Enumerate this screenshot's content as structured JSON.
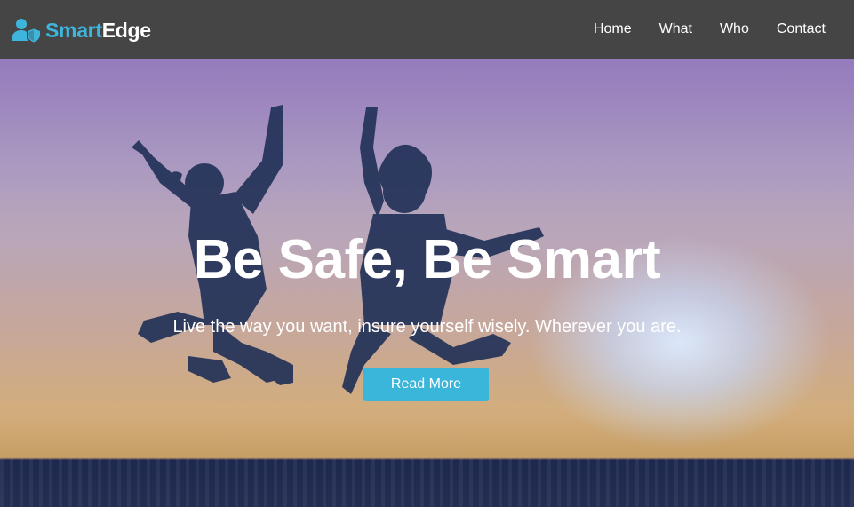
{
  "brand": {
    "icon": "user-shield-icon",
    "name_part1": "Smart",
    "name_part2": "Edge",
    "accent_color": "#3db5dc"
  },
  "nav": {
    "items": [
      {
        "label": "Home"
      },
      {
        "label": "What"
      },
      {
        "label": "Who"
      },
      {
        "label": "Contact"
      }
    ]
  },
  "hero": {
    "title": "Be Safe, Be Smart",
    "subtitle": "Live the way you want, insure yourself wisely. Wherever you are.",
    "button_label": "Read More",
    "button_color": "#3bb6db",
    "background": "jumping-people-silhouettes-sunset-sea"
  },
  "colors": {
    "navbar_bg": "#454545",
    "text": "#ffffff"
  }
}
